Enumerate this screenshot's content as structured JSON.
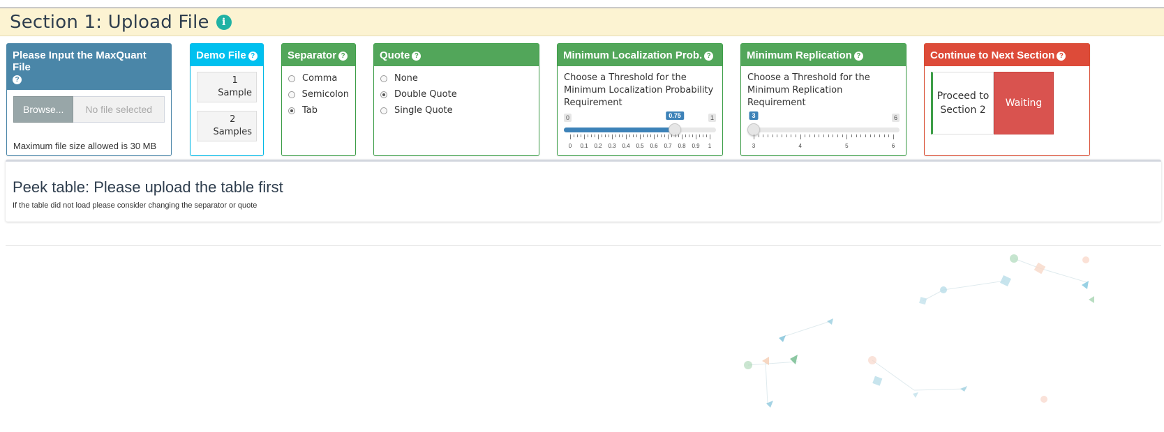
{
  "section": {
    "title": "Section 1: Upload File",
    "info_icon": "info-icon"
  },
  "upload": {
    "title": "Please Input the MaxQuant File",
    "browse_label": "Browse...",
    "file_placeholder": "No file selected",
    "help": "Maximum file size allowed is 30 MB"
  },
  "demo": {
    "title": "Demo File",
    "buttons": [
      {
        "line1": "1",
        "line2": "Sample"
      },
      {
        "line1": "2",
        "line2": "Samples"
      }
    ]
  },
  "separator": {
    "title": "Separator",
    "options": [
      "Comma",
      "Semicolon",
      "Tab"
    ],
    "selected": "Tab"
  },
  "quote": {
    "title": "Quote",
    "options": [
      "None",
      "Double Quote",
      "Single Quote"
    ],
    "selected": "Double Quote"
  },
  "localization": {
    "title": "Minimum Localization Prob.",
    "label": "Choose a Threshold for the Minimum Localization Probability Requirement",
    "min": 0,
    "max": 1,
    "value": 0.75,
    "min_label": "0",
    "max_label": "1",
    "value_label": "0.75",
    "tick_labels": [
      "0",
      "0.1",
      "0.2",
      "0.3",
      "0.4",
      "0.5",
      "0.6",
      "0.7",
      "0.8",
      "0.9",
      "1"
    ]
  },
  "replication": {
    "title": "Minimum Replication",
    "label": "Choose a Threshold for the Minimum Replication Requirement",
    "min": 3,
    "max": 6,
    "value": 3,
    "min_label": "3",
    "max_label": "6",
    "value_label": "3",
    "tick_labels": [
      "3",
      "4",
      "5",
      "6"
    ]
  },
  "next": {
    "title": "Continue to Next Section",
    "proceed_label": "Proceed to Section 2",
    "status": "Waiting"
  },
  "peek": {
    "title": "Peek table: Please upload the table first",
    "subtitle": "If the table did not load please consider changing the separator or quote"
  },
  "colors": {
    "header_bg": "#fcf3d2",
    "upload_blue": "#4a86a8",
    "demo_cyan": "#00c0ef",
    "box_green": "#52a65a",
    "next_red": "#dd4b39",
    "slider_blue": "#3d82b8"
  }
}
